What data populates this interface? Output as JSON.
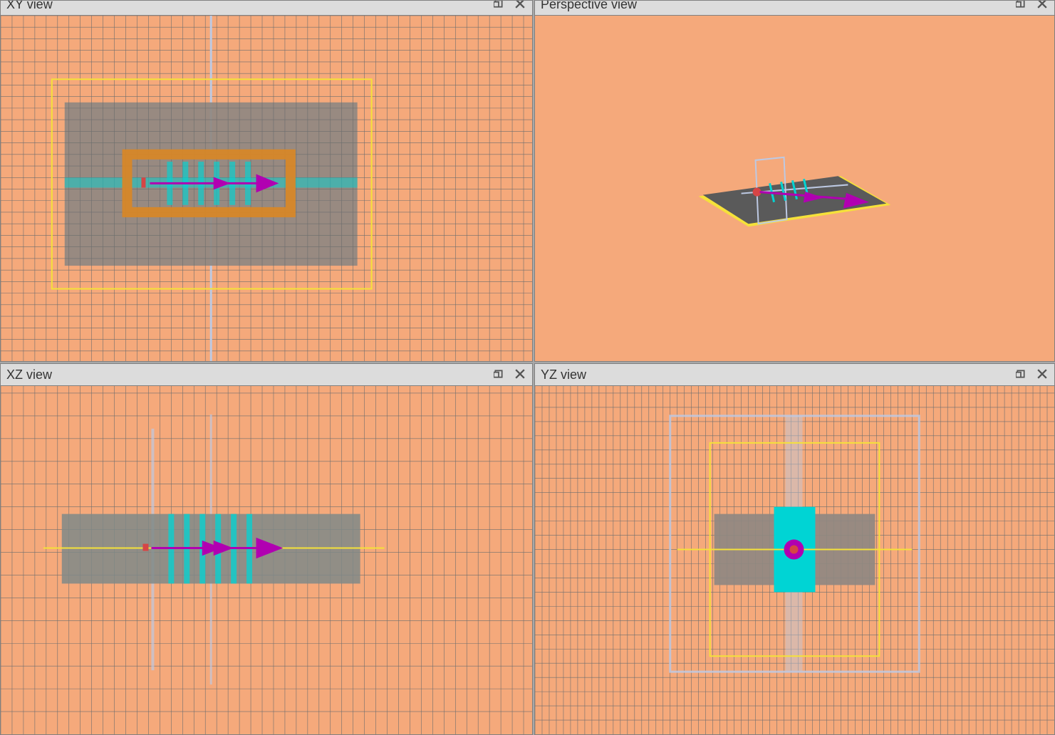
{
  "panels": {
    "xy": {
      "title": "XY view"
    },
    "persp": {
      "title": "Perspective view"
    },
    "xz": {
      "title": "XZ view"
    },
    "yz": {
      "title": "YZ view"
    }
  },
  "colors": {
    "bg": "#f5a97b",
    "grid": "#6e6e6e",
    "gridMinor": "#6e6e6e",
    "substrate": "#8f8881",
    "boundaryYellow": "#f5e13a",
    "probeBox": "#bdc9e3",
    "feedFrame": "#d68728",
    "dielectric": "#00d4d4",
    "arrow": "#b100b1",
    "port": "#d64545"
  },
  "scene": {
    "source_position": "center of feed along X",
    "arrow_direction": "+X",
    "yellow_box": "simulation boundary outline",
    "lightblue_plane": "source/port plane",
    "orange_frame": "patch antenna outline",
    "cyan_bars": "dielectric/substrate cross-sections",
    "note": "2x2 EM viewport layout (openEMS/CST style)"
  }
}
